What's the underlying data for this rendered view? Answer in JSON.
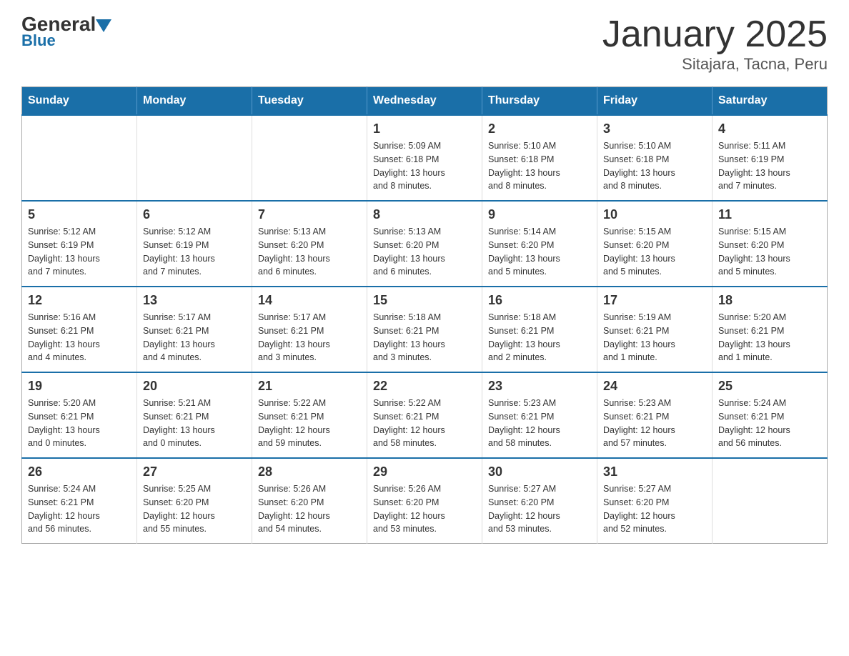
{
  "header": {
    "logo": {
      "general": "General",
      "blue": "Blue"
    },
    "title": "January 2025",
    "subtitle": "Sitajara, Tacna, Peru"
  },
  "calendar": {
    "days": [
      "Sunday",
      "Monday",
      "Tuesday",
      "Wednesday",
      "Thursday",
      "Friday",
      "Saturday"
    ],
    "weeks": [
      [
        {
          "day": "",
          "info": ""
        },
        {
          "day": "",
          "info": ""
        },
        {
          "day": "",
          "info": ""
        },
        {
          "day": "1",
          "info": "Sunrise: 5:09 AM\nSunset: 6:18 PM\nDaylight: 13 hours\nand 8 minutes."
        },
        {
          "day": "2",
          "info": "Sunrise: 5:10 AM\nSunset: 6:18 PM\nDaylight: 13 hours\nand 8 minutes."
        },
        {
          "day": "3",
          "info": "Sunrise: 5:10 AM\nSunset: 6:18 PM\nDaylight: 13 hours\nand 8 minutes."
        },
        {
          "day": "4",
          "info": "Sunrise: 5:11 AM\nSunset: 6:19 PM\nDaylight: 13 hours\nand 7 minutes."
        }
      ],
      [
        {
          "day": "5",
          "info": "Sunrise: 5:12 AM\nSunset: 6:19 PM\nDaylight: 13 hours\nand 7 minutes."
        },
        {
          "day": "6",
          "info": "Sunrise: 5:12 AM\nSunset: 6:19 PM\nDaylight: 13 hours\nand 7 minutes."
        },
        {
          "day": "7",
          "info": "Sunrise: 5:13 AM\nSunset: 6:20 PM\nDaylight: 13 hours\nand 6 minutes."
        },
        {
          "day": "8",
          "info": "Sunrise: 5:13 AM\nSunset: 6:20 PM\nDaylight: 13 hours\nand 6 minutes."
        },
        {
          "day": "9",
          "info": "Sunrise: 5:14 AM\nSunset: 6:20 PM\nDaylight: 13 hours\nand 5 minutes."
        },
        {
          "day": "10",
          "info": "Sunrise: 5:15 AM\nSunset: 6:20 PM\nDaylight: 13 hours\nand 5 minutes."
        },
        {
          "day": "11",
          "info": "Sunrise: 5:15 AM\nSunset: 6:20 PM\nDaylight: 13 hours\nand 5 minutes."
        }
      ],
      [
        {
          "day": "12",
          "info": "Sunrise: 5:16 AM\nSunset: 6:21 PM\nDaylight: 13 hours\nand 4 minutes."
        },
        {
          "day": "13",
          "info": "Sunrise: 5:17 AM\nSunset: 6:21 PM\nDaylight: 13 hours\nand 4 minutes."
        },
        {
          "day": "14",
          "info": "Sunrise: 5:17 AM\nSunset: 6:21 PM\nDaylight: 13 hours\nand 3 minutes."
        },
        {
          "day": "15",
          "info": "Sunrise: 5:18 AM\nSunset: 6:21 PM\nDaylight: 13 hours\nand 3 minutes."
        },
        {
          "day": "16",
          "info": "Sunrise: 5:18 AM\nSunset: 6:21 PM\nDaylight: 13 hours\nand 2 minutes."
        },
        {
          "day": "17",
          "info": "Sunrise: 5:19 AM\nSunset: 6:21 PM\nDaylight: 13 hours\nand 1 minute."
        },
        {
          "day": "18",
          "info": "Sunrise: 5:20 AM\nSunset: 6:21 PM\nDaylight: 13 hours\nand 1 minute."
        }
      ],
      [
        {
          "day": "19",
          "info": "Sunrise: 5:20 AM\nSunset: 6:21 PM\nDaylight: 13 hours\nand 0 minutes."
        },
        {
          "day": "20",
          "info": "Sunrise: 5:21 AM\nSunset: 6:21 PM\nDaylight: 13 hours\nand 0 minutes."
        },
        {
          "day": "21",
          "info": "Sunrise: 5:22 AM\nSunset: 6:21 PM\nDaylight: 12 hours\nand 59 minutes."
        },
        {
          "day": "22",
          "info": "Sunrise: 5:22 AM\nSunset: 6:21 PM\nDaylight: 12 hours\nand 58 minutes."
        },
        {
          "day": "23",
          "info": "Sunrise: 5:23 AM\nSunset: 6:21 PM\nDaylight: 12 hours\nand 58 minutes."
        },
        {
          "day": "24",
          "info": "Sunrise: 5:23 AM\nSunset: 6:21 PM\nDaylight: 12 hours\nand 57 minutes."
        },
        {
          "day": "25",
          "info": "Sunrise: 5:24 AM\nSunset: 6:21 PM\nDaylight: 12 hours\nand 56 minutes."
        }
      ],
      [
        {
          "day": "26",
          "info": "Sunrise: 5:24 AM\nSunset: 6:21 PM\nDaylight: 12 hours\nand 56 minutes."
        },
        {
          "day": "27",
          "info": "Sunrise: 5:25 AM\nSunset: 6:20 PM\nDaylight: 12 hours\nand 55 minutes."
        },
        {
          "day": "28",
          "info": "Sunrise: 5:26 AM\nSunset: 6:20 PM\nDaylight: 12 hours\nand 54 minutes."
        },
        {
          "day": "29",
          "info": "Sunrise: 5:26 AM\nSunset: 6:20 PM\nDaylight: 12 hours\nand 53 minutes."
        },
        {
          "day": "30",
          "info": "Sunrise: 5:27 AM\nSunset: 6:20 PM\nDaylight: 12 hours\nand 53 minutes."
        },
        {
          "day": "31",
          "info": "Sunrise: 5:27 AM\nSunset: 6:20 PM\nDaylight: 12 hours\nand 52 minutes."
        },
        {
          "day": "",
          "info": ""
        }
      ]
    ]
  }
}
